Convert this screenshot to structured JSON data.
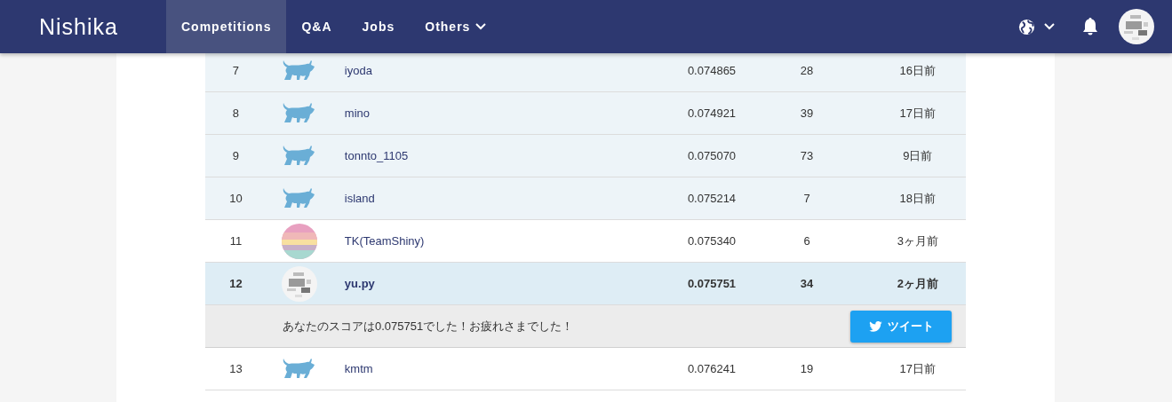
{
  "navbar": {
    "logo": "Nishika",
    "items": [
      {
        "label": "Competitions",
        "selected": true,
        "dropdown": false
      },
      {
        "label": "Q&A",
        "selected": false,
        "dropdown": false
      },
      {
        "label": "Jobs",
        "selected": false,
        "dropdown": false
      },
      {
        "label": "Others",
        "selected": false,
        "dropdown": true
      }
    ]
  },
  "leaderboard": {
    "rows": [
      {
        "rank": "7",
        "avatar": {
          "kind": "icon"
        },
        "name": "iyoda",
        "score": "0.074865",
        "entries": "28",
        "last": "16日前",
        "shaded": true,
        "selected": false
      },
      {
        "rank": "8",
        "avatar": {
          "kind": "icon"
        },
        "name": "mino",
        "score": "0.074921",
        "entries": "39",
        "last": "17日前",
        "shaded": true,
        "selected": false
      },
      {
        "rank": "9",
        "avatar": {
          "kind": "icon"
        },
        "name": "tonnto_1105",
        "score": "0.075070",
        "entries": "73",
        "last": "9日前",
        "shaded": true,
        "selected": false
      },
      {
        "rank": "10",
        "avatar": {
          "kind": "icon"
        },
        "name": "island",
        "score": "0.075214",
        "entries": "7",
        "last": "18日前",
        "shaded": true,
        "selected": false
      },
      {
        "rank": "11",
        "name": "TK(TeamShiny)",
        "score": "0.075340",
        "entries": "6",
        "last": "3ヶ月前",
        "shaded": false,
        "selected": false
      },
      {
        "rank": "12",
        "name": "yu.py",
        "score": "0.075751",
        "entries": "34",
        "last": "2ヶ月前",
        "shaded": false,
        "selected": true,
        "share": {
          "message": "あなたのスコアは0.075751でした！お疲れさまでした！",
          "button": "ツイート"
        }
      },
      {
        "rank": "13",
        "avatar": {
          "kind": "icon"
        },
        "name": "kmtm",
        "score": "0.076241",
        "entries": "19",
        "last": "17日前",
        "shaded": false,
        "selected": false
      }
    ]
  }
}
